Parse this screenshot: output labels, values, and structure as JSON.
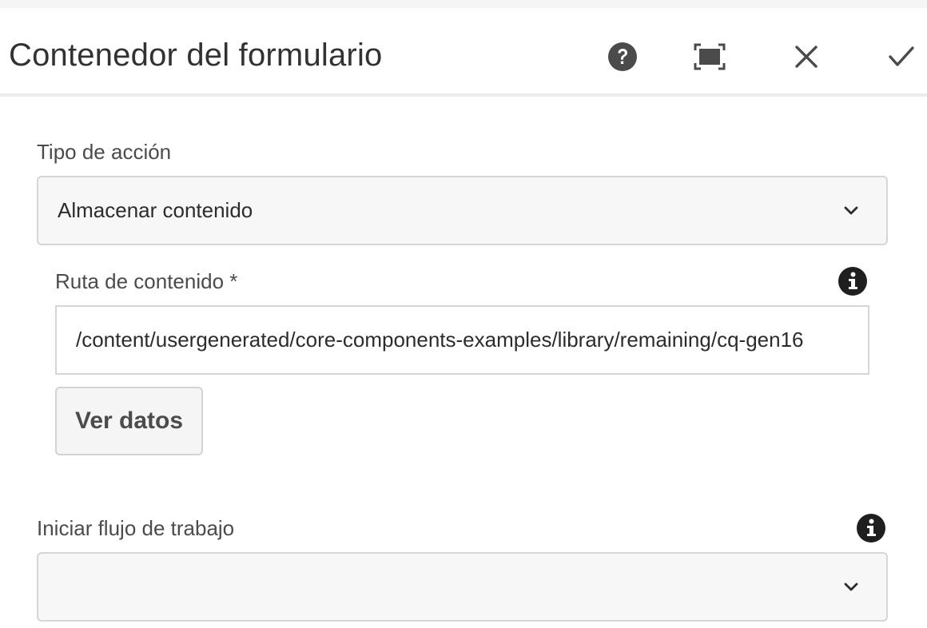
{
  "dialog": {
    "title": "Contenedor del formulario",
    "header_icons": [
      "help-icon",
      "fullscreen-icon",
      "close-icon",
      "checkmark-icon"
    ]
  },
  "action_type": {
    "label": "Tipo de acción",
    "selected": "Almacenar contenido"
  },
  "content_path": {
    "label": "Ruta de contenido *",
    "value": "/content/usergenerated/core-components-examples/library/remaining/cq-gen16",
    "info_icon": "info-icon"
  },
  "view_data_button": {
    "label": "Ver datos"
  },
  "workflow": {
    "label": "Iniciar flujo de trabajo",
    "selected": "",
    "info_icon": "info-icon"
  },
  "colors": {
    "text": "#323232",
    "icon": "#4b4b4b",
    "field_border": "#d6d6d6",
    "field_bg": "#f7f7f7"
  }
}
